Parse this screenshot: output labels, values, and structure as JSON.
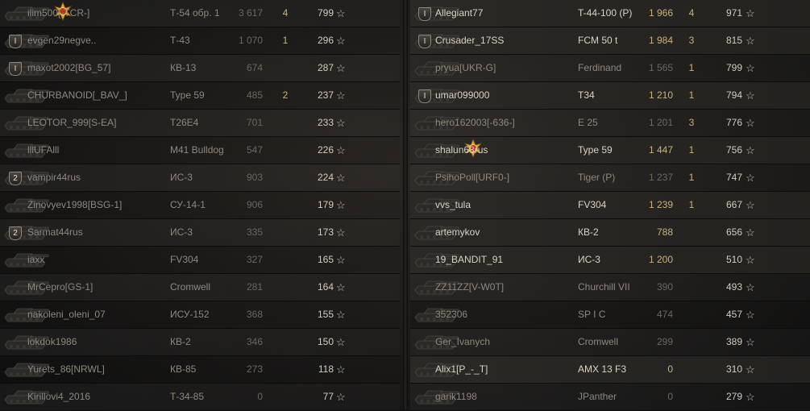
{
  "left_team": [
    {
      "player": "ilim500[-TCR-]",
      "badge": "",
      "tank": "Т-54 обр. 1",
      "damage": "3 617",
      "kills": "4",
      "xp": "799",
      "medal": true,
      "alive": false
    },
    {
      "player": "evgen29negve..",
      "badge": "I",
      "tank": "Т-43",
      "damage": "1 070",
      "kills": "1",
      "xp": "296",
      "medal": false,
      "alive": false
    },
    {
      "player": "maxot2002[BG_57]",
      "badge": "I",
      "tank": "КВ-13",
      "damage": "674",
      "kills": "",
      "xp": "287",
      "medal": false,
      "alive": false
    },
    {
      "player": "CHURBANOID[_BAV_]",
      "badge": "",
      "tank": "Type 59",
      "damage": "485",
      "kills": "2",
      "xp": "237",
      "medal": false,
      "alive": false
    },
    {
      "player": "LEOTOR_999[S-EA]",
      "badge": "",
      "tank": "T26E4",
      "damage": "701",
      "kills": "",
      "xp": "233",
      "medal": false,
      "alive": false
    },
    {
      "player": "lllUFAlll",
      "badge": "",
      "tank": "M41 Bulldog",
      "damage": "547",
      "kills": "",
      "xp": "226",
      "medal": false,
      "alive": false
    },
    {
      "player": "vampir44rus",
      "badge": "2",
      "tank": "ИС-3",
      "damage": "903",
      "kills": "",
      "xp": "224",
      "medal": false,
      "alive": false
    },
    {
      "player": "Zinovyev1998[BSG-1]",
      "badge": "",
      "tank": "СУ-14-1",
      "damage": "906",
      "kills": "",
      "xp": "179",
      "medal": false,
      "alive": false
    },
    {
      "player": "Sarmat44rus",
      "badge": "2",
      "tank": "ИС-3",
      "damage": "335",
      "kills": "",
      "xp": "173",
      "medal": false,
      "alive": false
    },
    {
      "player": "iaxx",
      "badge": "",
      "tank": "FV304",
      "damage": "327",
      "kills": "",
      "xp": "165",
      "medal": false,
      "alive": false
    },
    {
      "player": "MrCepro[GS-1]",
      "badge": "",
      "tank": "Cromwell",
      "damage": "281",
      "kills": "",
      "xp": "164",
      "medal": false,
      "alive": false
    },
    {
      "player": "nakoleni_oleni_07",
      "badge": "",
      "tank": "ИСУ-152",
      "damage": "368",
      "kills": "",
      "xp": "155",
      "medal": false,
      "alive": false
    },
    {
      "player": "lokdok1986",
      "badge": "",
      "tank": "КВ-2",
      "damage": "346",
      "kills": "",
      "xp": "150",
      "medal": false,
      "alive": false
    },
    {
      "player": "Yurets_86[NRWL]",
      "badge": "",
      "tank": "КВ-85",
      "damage": "273",
      "kills": "",
      "xp": "118",
      "medal": false,
      "alive": false
    },
    {
      "player": "Kirillovi4_2016",
      "badge": "",
      "tank": "Т-34-85",
      "damage": "0",
      "kills": "",
      "xp": "77",
      "medal": false,
      "alive": false
    }
  ],
  "right_team": [
    {
      "player": "Allegiant77",
      "badge": "I",
      "tank": "T-44-100 (P)",
      "damage": "1 966",
      "kills": "4",
      "xp": "971",
      "medal": false,
      "alive": true
    },
    {
      "player": "Crusader_17SS",
      "badge": "I",
      "tank": "FCM 50 t",
      "damage": "1 984",
      "kills": "3",
      "xp": "815",
      "medal": false,
      "alive": true
    },
    {
      "player": "pryua[UKR-G]",
      "badge": "",
      "tank": "Ferdinand",
      "damage": "1 565",
      "kills": "1",
      "xp": "799",
      "medal": false,
      "alive": false
    },
    {
      "player": "umar099000",
      "badge": "I",
      "tank": "T34",
      "damage": "1 210",
      "kills": "1",
      "xp": "794",
      "medal": false,
      "alive": true
    },
    {
      "player": "hero162003[-636-]",
      "badge": "",
      "tank": "E 25",
      "damage": "1 201",
      "kills": "3",
      "xp": "776",
      "medal": false,
      "alive": false
    },
    {
      "player": "shalun68rus",
      "badge": "",
      "tank": "Type 59",
      "damage": "1 447",
      "kills": "1",
      "xp": "756",
      "medal": true,
      "alive": true
    },
    {
      "player": "PsihoPoll[URF0-]",
      "badge": "",
      "tank": "Tiger (P)",
      "damage": "1 237",
      "kills": "1",
      "xp": "747",
      "medal": false,
      "alive": false
    },
    {
      "player": "vvs_tula",
      "badge": "",
      "tank": "FV304",
      "damage": "1 239",
      "kills": "1",
      "xp": "667",
      "medal": false,
      "alive": true
    },
    {
      "player": "artemykov",
      "badge": "",
      "tank": "КВ-2",
      "damage": "788",
      "kills": "",
      "xp": "656",
      "medal": false,
      "alive": true
    },
    {
      "player": "19_BANDIT_91",
      "badge": "",
      "tank": "ИС-3",
      "damage": "1 200",
      "kills": "",
      "xp": "510",
      "medal": false,
      "alive": true
    },
    {
      "player": "ZZ11ZZ[V-W0T]",
      "badge": "",
      "tank": "Churchill VII",
      "damage": "390",
      "kills": "",
      "xp": "493",
      "medal": false,
      "alive": false
    },
    {
      "player": "352306",
      "badge": "",
      "tank": "SP I C",
      "damage": "474",
      "kills": "",
      "xp": "457",
      "medal": false,
      "alive": false
    },
    {
      "player": "Ger_Ivanych",
      "badge": "",
      "tank": "Cromwell",
      "damage": "299",
      "kills": "",
      "xp": "389",
      "medal": false,
      "alive": false
    },
    {
      "player": "Alix1[P_-_T]",
      "badge": "",
      "tank": "AMX 13 F3",
      "damage": "0",
      "kills": "",
      "xp": "310",
      "medal": false,
      "alive": true
    },
    {
      "player": "garik1198",
      "badge": "",
      "tank": "JPanther",
      "damage": "0",
      "kills": "",
      "xp": "279",
      "medal": false,
      "alive": false
    }
  ],
  "icons": {
    "star": "star-icon",
    "medal": "medal-icon",
    "badge": "rank-badge-icon",
    "tank": "tank-silhouette-icon"
  },
  "colors": {
    "background": "#1a1918",
    "alive_text": "#d9d3c5",
    "dead_text": "#8e887d",
    "kills": "#c9b27a",
    "medal": "#d9a53b"
  }
}
